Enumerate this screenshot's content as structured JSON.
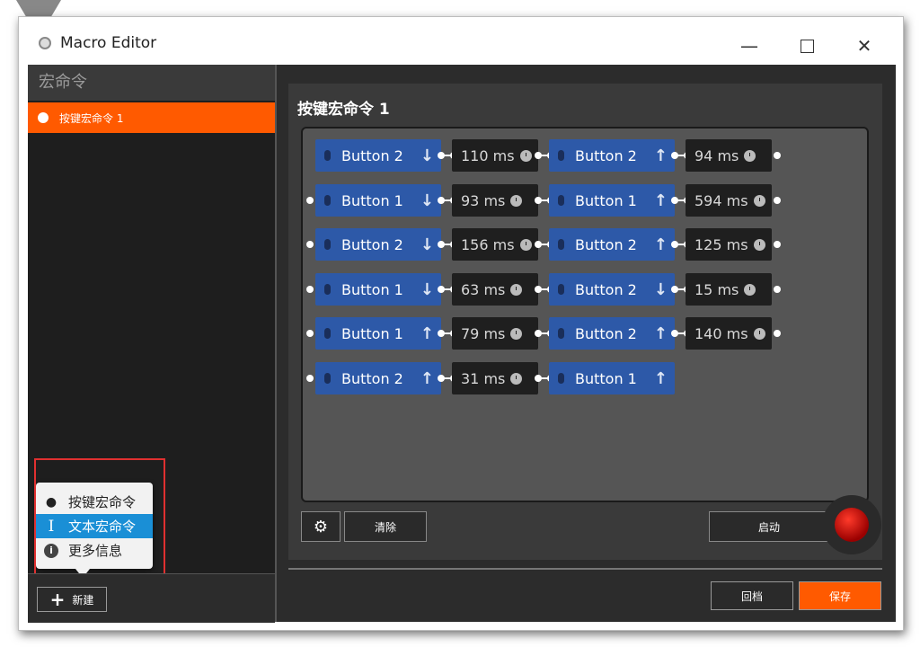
{
  "window": {
    "title": "Macro Editor",
    "minimize_icon": "minimize-icon",
    "maximize_icon": "maximize-icon",
    "close_icon": "close-icon"
  },
  "sidebar": {
    "header": "宏命令",
    "items": [
      {
        "label": "按键宏命令 1",
        "selected": true
      }
    ],
    "new_button": "新建"
  },
  "popup_menu": {
    "items": [
      {
        "label": "按键宏命令",
        "icon": "circle-icon",
        "selected": false
      },
      {
        "label": "文本宏命令",
        "icon": "text-cursor-icon",
        "selected": true
      },
      {
        "label": "更多信息",
        "icon": "info-icon",
        "selected": false
      }
    ]
  },
  "main": {
    "title": "按键宏命令 1",
    "rows": [
      {
        "steps": [
          {
            "button": "Button 2",
            "dir": "down"
          },
          {
            "delay": "110 ms"
          },
          {
            "button": "Button 2",
            "dir": "up"
          },
          {
            "delay": "94 ms"
          }
        ]
      },
      {
        "steps": [
          {
            "button": "Button 1",
            "dir": "down"
          },
          {
            "delay": "93 ms"
          },
          {
            "button": "Button 1",
            "dir": "up"
          },
          {
            "delay": "594 ms"
          }
        ]
      },
      {
        "steps": [
          {
            "button": "Button 2",
            "dir": "down"
          },
          {
            "delay": "156 ms"
          },
          {
            "button": "Button 2",
            "dir": "up"
          },
          {
            "delay": "125 ms"
          }
        ]
      },
      {
        "steps": [
          {
            "button": "Button 1",
            "dir": "down"
          },
          {
            "delay": "63 ms"
          },
          {
            "button": "Button 2",
            "dir": "down"
          },
          {
            "delay": "15 ms"
          }
        ]
      },
      {
        "steps": [
          {
            "button": "Button 1",
            "dir": "up"
          },
          {
            "delay": "79 ms"
          },
          {
            "button": "Button 2",
            "dir": "up"
          },
          {
            "delay": "140 ms"
          }
        ]
      },
      {
        "steps": [
          {
            "button": "Button 2",
            "dir": "up"
          },
          {
            "delay": "31 ms"
          },
          {
            "button": "Button 1",
            "dir": "up"
          }
        ]
      }
    ],
    "clear_button": "清除",
    "start_button": "启动",
    "back_button": "回档",
    "save_button": "保存"
  },
  "colors": {
    "accent": "#ff5a00",
    "button_block": "#2d59a8",
    "delay_block": "#1f1f1f",
    "popup_selected": "#1a8fd6",
    "highlight_border": "#e03030"
  }
}
